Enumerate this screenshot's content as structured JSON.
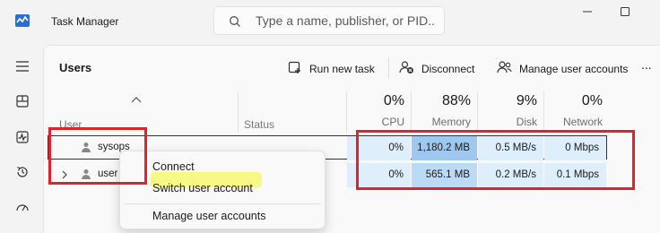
{
  "app": {
    "title": "Task Manager"
  },
  "search": {
    "placeholder": "Type a name, publisher, or PID..."
  },
  "page": {
    "title": "Users"
  },
  "toolbar": {
    "run_new_task": "Run new task",
    "disconnect": "Disconnect",
    "manage_user_accounts": "Manage user accounts",
    "more": "..."
  },
  "columns": {
    "user": "User",
    "status": "Status",
    "cpu": {
      "percent": "0%",
      "label": "CPU"
    },
    "memory": {
      "percent": "88%",
      "label": "Memory"
    },
    "disk": {
      "percent": "9%",
      "label": "Disk"
    },
    "network": {
      "percent": "0%",
      "label": "Network"
    }
  },
  "rows": [
    {
      "name": "sysops",
      "status": "",
      "cpu": "0%",
      "memory": "1,180.2 MB",
      "disk": "0.5 MB/s",
      "network": "0 Mbps"
    },
    {
      "name": "user",
      "status": "",
      "cpu": "0%",
      "memory": "565.1 MB",
      "disk": "0.2 MB/s",
      "network": "0.1 Mbps"
    }
  ],
  "context_menu": {
    "items": [
      "Connect",
      "Switch user account",
      "Manage user accounts"
    ]
  },
  "colors": {
    "memory_heat_high": "#9ec8ef",
    "heat_low": "#deeefb",
    "annotation": "#e5202a",
    "highlight": "#f7f77a"
  }
}
